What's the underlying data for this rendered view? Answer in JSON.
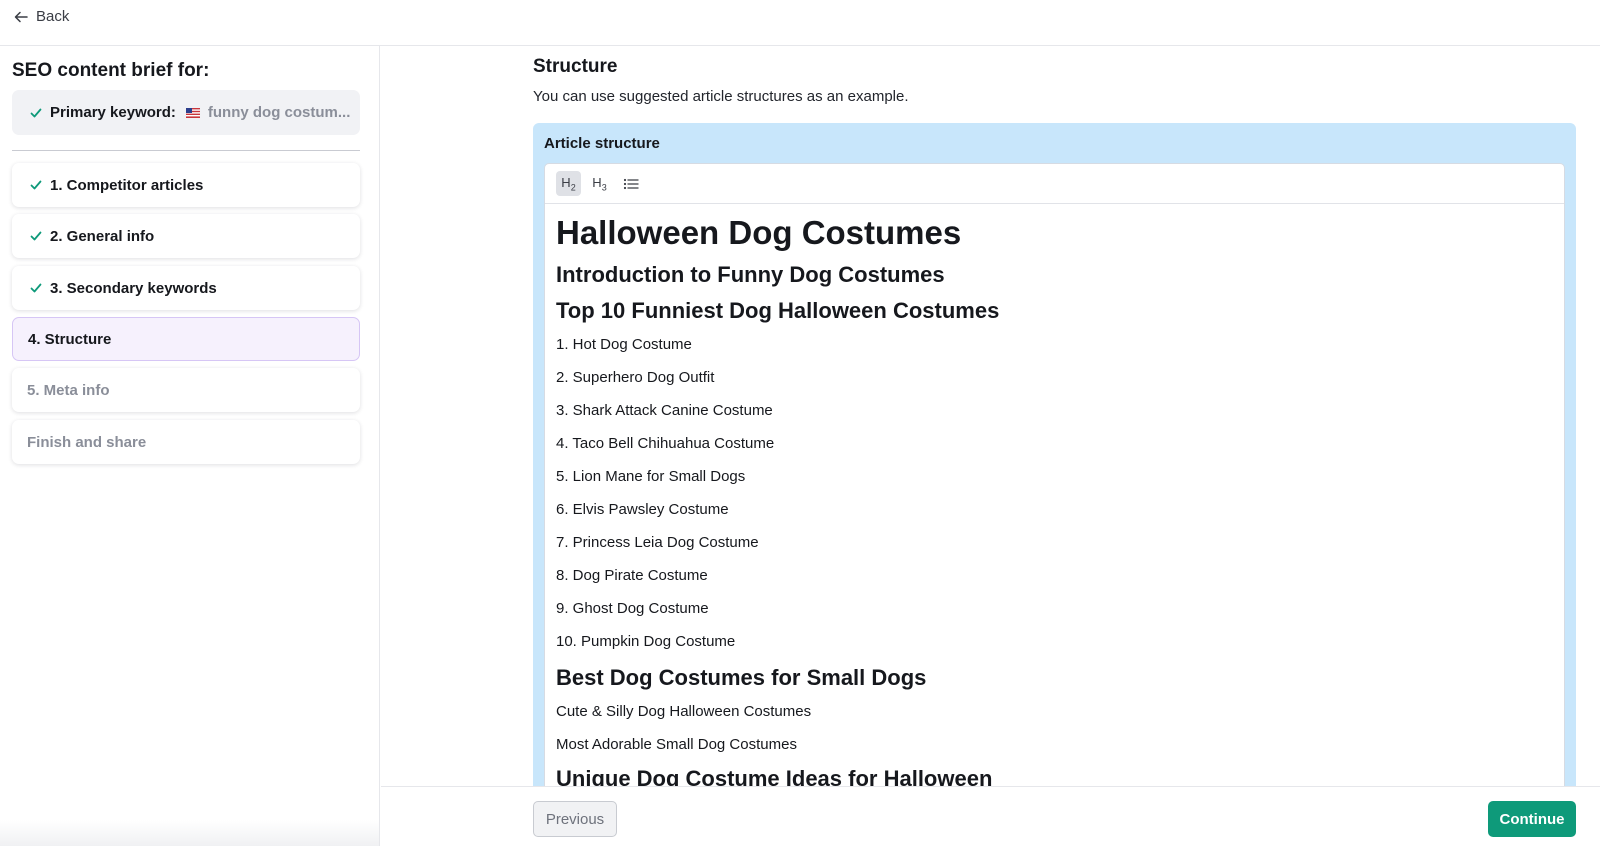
{
  "topbar": {
    "back_label": "Back"
  },
  "sidebar": {
    "title": "SEO content brief for:",
    "keyword_label": "Primary keyword:",
    "keyword_value": "funny dog costum...",
    "steps": [
      {
        "label": "1. Competitor articles",
        "state": "done"
      },
      {
        "label": "2. General info",
        "state": "done"
      },
      {
        "label": "3. Secondary keywords",
        "state": "done"
      },
      {
        "label": "4. Structure",
        "state": "active"
      },
      {
        "label": "5. Meta info",
        "state": "disabled"
      },
      {
        "label": "Finish and share",
        "state": "disabled"
      }
    ]
  },
  "main": {
    "title": "Structure",
    "subtitle": "You can use suggested article structures as an example.",
    "panel_label": "Article structure",
    "toolbar": {
      "h2": "H",
      "h2_sub": "2",
      "h3": "H",
      "h3_sub": "3"
    },
    "article": {
      "h1": "Halloween Dog Costumes",
      "intro_heading": "Introduction to Funny Dog Costumes",
      "top10_heading": "Top 10 Funniest Dog Halloween Costumes",
      "top10_items": [
        "1. Hot Dog Costume",
        "2. Superhero Dog Outfit",
        "3. Shark Attack Canine Costume",
        "4. Taco Bell Chihuahua Costume",
        "5. Lion Mane for Small Dogs",
        "6. Elvis Pawsley Costume",
        "7. Princess Leia Dog Costume",
        "8. Dog Pirate Costume",
        "9. Ghost Dog Costume",
        "10. Pumpkin Dog Costume"
      ],
      "small_dogs_heading": "Best Dog Costumes for Small Dogs",
      "small_dogs_items": [
        "Cute & Silly Dog Halloween Costumes",
        "Most Adorable Small Dog Costumes"
      ],
      "unique_heading": "Unique Dog Costume Ideas for Halloween"
    }
  },
  "footer": {
    "previous_label": "Previous",
    "continue_label": "Continue"
  },
  "colors": {
    "accent_green": "#0e9a7a",
    "panel_blue": "#c8e6fb",
    "active_step_bg": "#f6f1fd",
    "check_green": "#0e9a7a"
  }
}
